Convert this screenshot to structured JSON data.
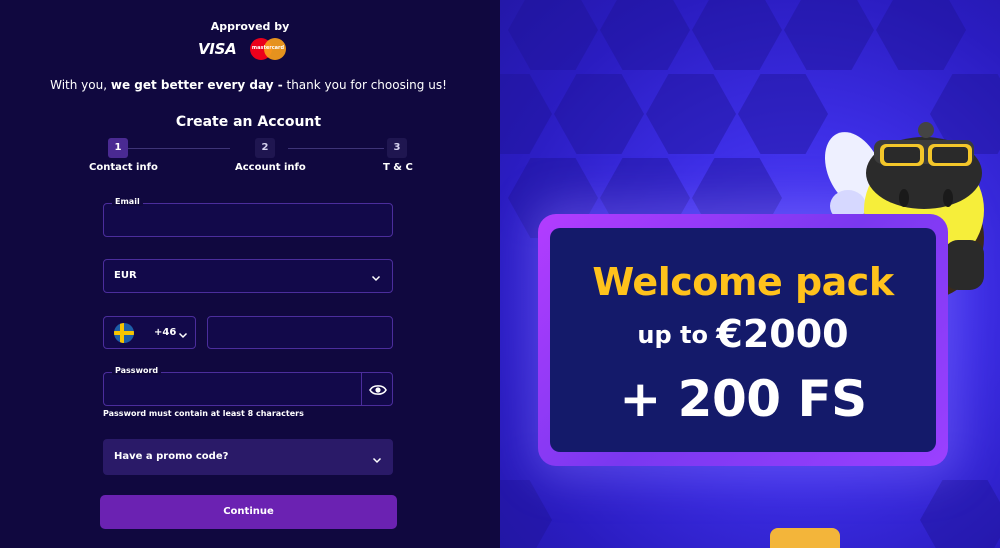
{
  "header": {
    "approved_label": "Approved by",
    "visa_label": "VISA",
    "mastercard_label": "mastercard"
  },
  "tagline": {
    "prefix": "With you, ",
    "bold": "we get better every day -",
    "suffix": " thank you for choosing us!"
  },
  "form": {
    "title": "Create an Account",
    "steps": [
      {
        "number": "1",
        "label": "Contact info",
        "active": true
      },
      {
        "number": "2",
        "label": "Account info",
        "active": false
      },
      {
        "number": "3",
        "label": "T & C",
        "active": false
      }
    ],
    "email": {
      "label": "Email",
      "value": ""
    },
    "currency": {
      "value": "EUR"
    },
    "phone": {
      "country_icon": "sweden-flag-icon",
      "prefix": "+46",
      "value": ""
    },
    "password": {
      "label": "Password",
      "value": "",
      "hint": "Password must contain at least 8 characters"
    },
    "promo": {
      "label": "Have a promo code?"
    },
    "continue_label": "Continue"
  },
  "promotion": {
    "title": "Welcome pack",
    "up_to": "up to",
    "amount": "€2000",
    "free_spins": "+ 200 FS"
  },
  "colors": {
    "background": "#10083f",
    "accent": "#6b22b2",
    "field_border": "#4b2d9c",
    "promo_title": "#ffc21c"
  }
}
